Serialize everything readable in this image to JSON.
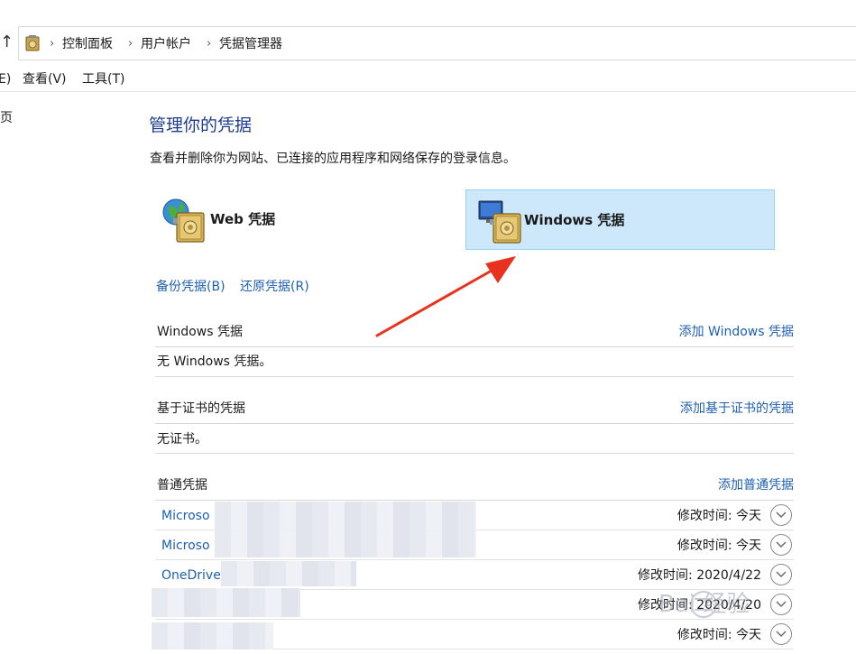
{
  "breadcrumb": {
    "items": [
      "控制面板",
      "用户帐户",
      "凭据管理器"
    ],
    "separator": "›"
  },
  "menubar": {
    "partial_edit": "E)",
    "view": "查看(V)",
    "tools": "工具(T)"
  },
  "left_nav": {
    "partial_home": "页"
  },
  "page": {
    "title": "管理你的凭据",
    "description": "查看并删除你为网站、已连接的应用程序和网络保存的登录信息。"
  },
  "tiles": {
    "web_label": "Web 凭据",
    "windows_label": "Windows 凭据",
    "selected": "windows"
  },
  "links": {
    "backup": "备份凭据(B)",
    "restore": "还原凭据(R)"
  },
  "sections": {
    "windows": {
      "title": "Windows 凭据",
      "add": "添加 Windows 凭据",
      "empty": "无 Windows 凭据。"
    },
    "certificate": {
      "title": "基于证书的凭据",
      "add": "添加基于证书的凭据",
      "empty": "无证书。"
    },
    "generic": {
      "title": "普通凭据",
      "add": "添加普通凭据",
      "rows": [
        {
          "name": "Microso",
          "modified": "修改时间:  今天"
        },
        {
          "name": "Microso",
          "modified": "修改时间:  今天"
        },
        {
          "name": "OneDrive",
          "modified": "修改时间:  2020/4/22"
        },
        {
          "name": "",
          "modified": "修改时间:  2020/4/20"
        },
        {
          "name": "",
          "modified": "修改时间:  今天"
        }
      ]
    }
  },
  "watermark": "Bai 经验",
  "colors": {
    "link": "#1e5fb0",
    "title": "#1e3d8c",
    "selected_tile": "#cce8fa",
    "arrow": "#e8321e"
  }
}
